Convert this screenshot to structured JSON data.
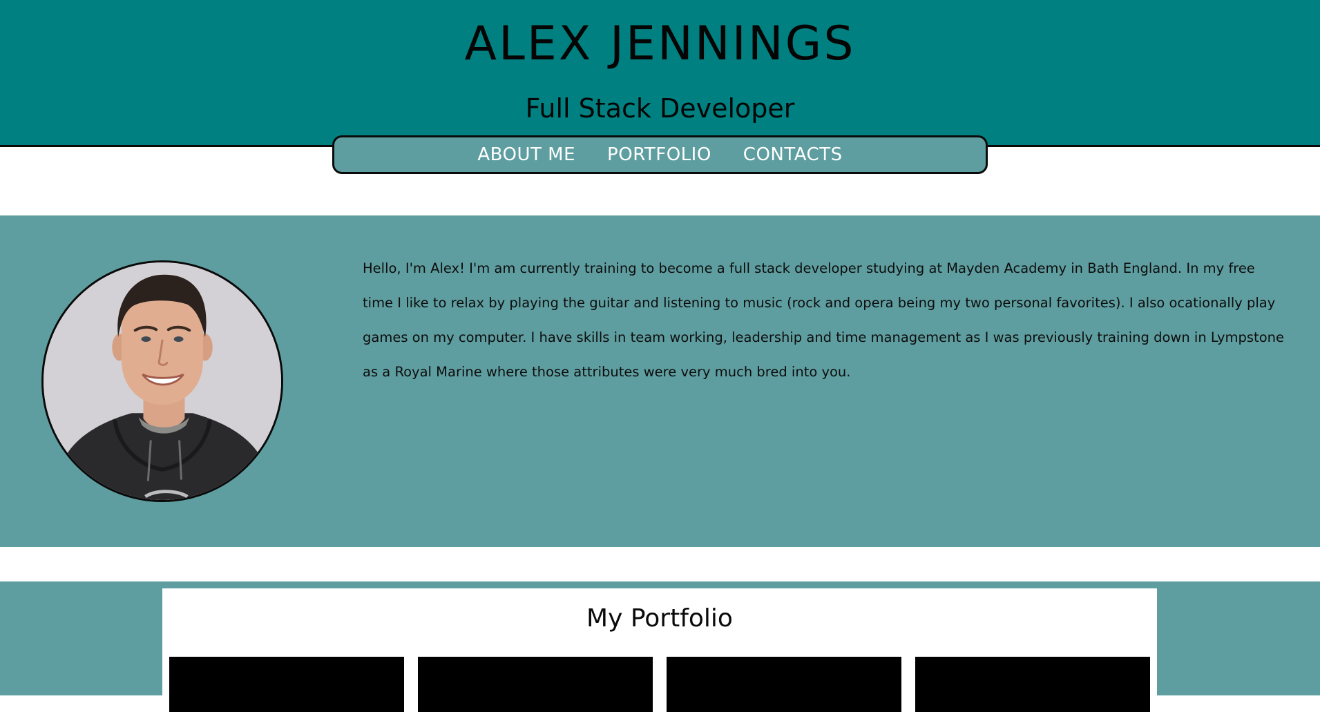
{
  "header": {
    "title": "ALEX JENNINGS",
    "subtitle": "Full Stack Developer"
  },
  "nav": {
    "items": [
      {
        "label": "ABOUT ME"
      },
      {
        "label": "PORTFOLIO"
      },
      {
        "label": "CONTACTS"
      }
    ]
  },
  "about": {
    "text": "Hello, I'm Alex! I'm am currently training to become a full stack developer studying at Mayden Academy in Bath England. In my free time I like to relax by playing the guitar and listening to music (rock and opera being my two personal favorites). I also ocationally play games on my computer. I have skills in team working, leadership and time management as I was previously training down in Lympstone as a Royal Marine where those attributes were very much bred into you."
  },
  "portfolio": {
    "title": "My Portfolio",
    "card_count": 4
  },
  "colors": {
    "header_bg": "#008080",
    "section_bg": "#5f9ea0",
    "nav_text": "#ffffff",
    "card_bg": "#000000"
  }
}
